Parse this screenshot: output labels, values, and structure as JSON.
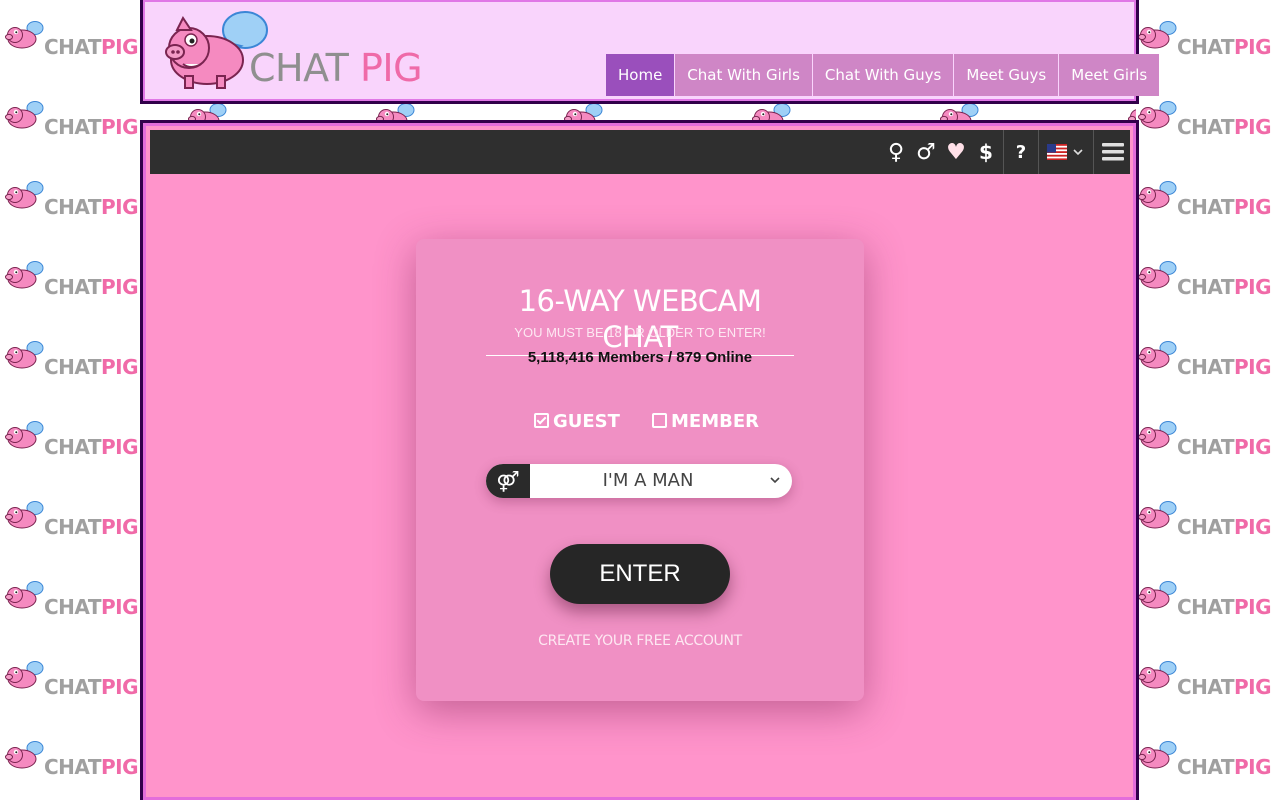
{
  "brand": {
    "name_part1": "CHAT",
    "name_part2": "PIG",
    "tile_part1": "CHAT",
    "tile_part2": "PIG"
  },
  "nav": {
    "items": [
      {
        "label": "Home",
        "active": true
      },
      {
        "label": "Chat With Girls",
        "active": false
      },
      {
        "label": "Chat With Guys",
        "active": false
      },
      {
        "label": "Meet Guys",
        "active": false
      },
      {
        "label": "Meet Girls",
        "active": false
      }
    ]
  },
  "toolbar": {
    "icons": [
      "female-icon",
      "male-icon",
      "heart-icon",
      "dollar-icon",
      "help-icon",
      "us-flag-icon",
      "menu-icon"
    ],
    "female_glyph": "♀",
    "male_glyph": "♂",
    "heart_glyph": "♥",
    "dollar_glyph": "$",
    "help_glyph": "?"
  },
  "login": {
    "title": "16-WAY WEBCAM CHAT",
    "age_notice": "YOU MUST BE 18 OR OLDER TO ENTER!",
    "member_count": "5,118,416 Members / 879 Online",
    "mode_guest": "GUEST",
    "mode_member": "MEMBER",
    "gender_value": "I'M A MAN",
    "enter_label": "ENTER",
    "create_account": "CREATE YOUR FREE ACCOUNT"
  },
  "colors": {
    "header_bg": "#f9d4fc",
    "main_bg": "#ff94cb",
    "nav_active": "#9a4fbc",
    "nav_item": "#cf86c6",
    "toolbar_bg": "#2f2f2f",
    "frame_border": "#31004a"
  }
}
